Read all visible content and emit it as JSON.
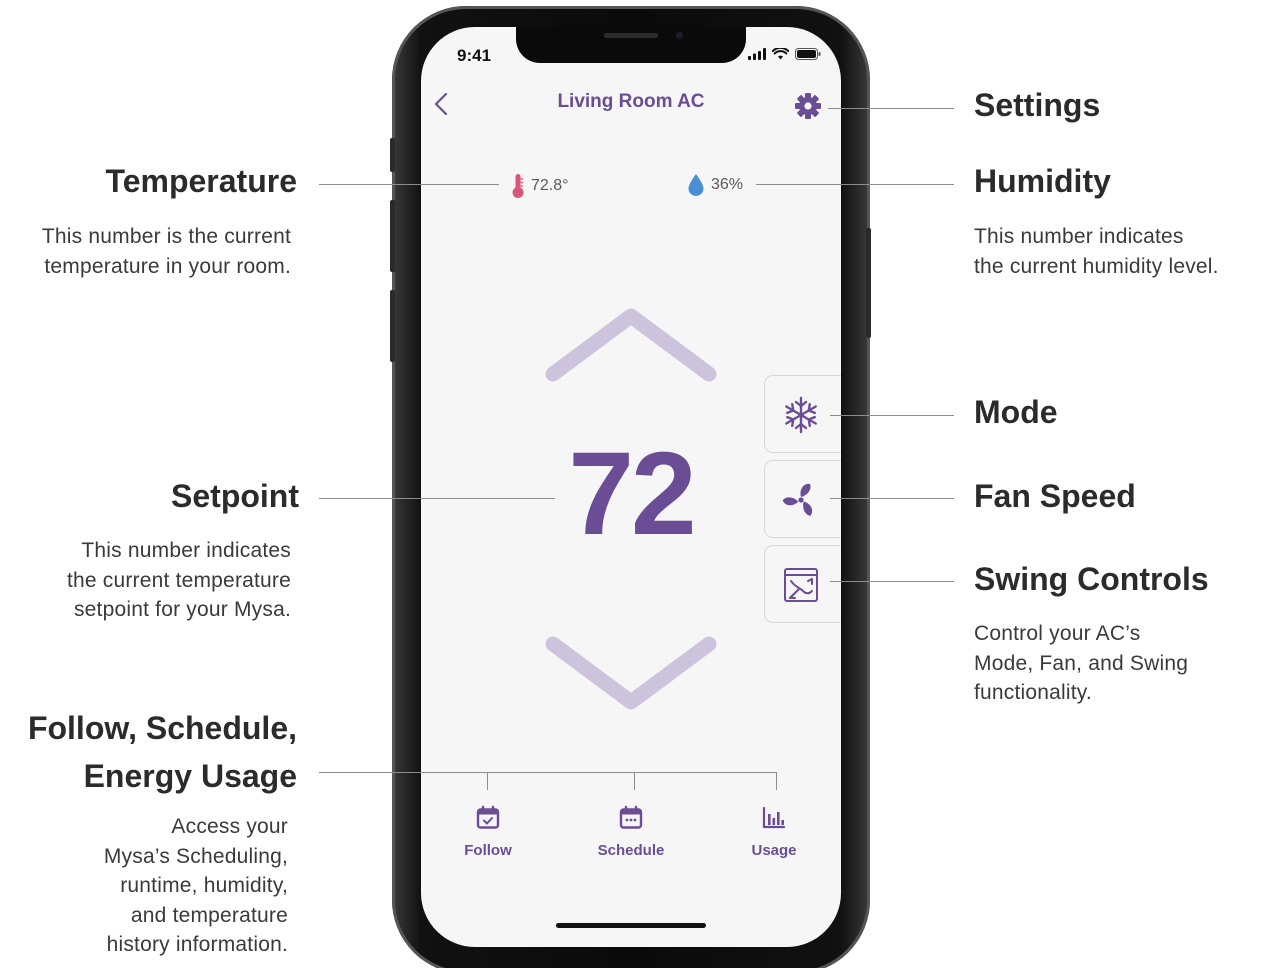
{
  "status_bar": {
    "time": "9:41"
  },
  "nav": {
    "title": "Living Room AC"
  },
  "readings": {
    "temperature": "72.8°",
    "humidity": "36%"
  },
  "setpoint": "72",
  "tabs": [
    {
      "label": "Follow",
      "icon": "calendar-check-icon"
    },
    {
      "label": "Schedule",
      "icon": "calendar-icon"
    },
    {
      "label": "Usage",
      "icon": "bar-chart-icon"
    }
  ],
  "controls": [
    {
      "name": "Mode",
      "icon": "snowflake-icon"
    },
    {
      "name": "Fan Speed",
      "icon": "fan-icon"
    },
    {
      "name": "Swing Controls",
      "icon": "swing-icon"
    }
  ],
  "annotations": {
    "settings": {
      "title": "Settings"
    },
    "temperature": {
      "title": "Temperature",
      "desc_lines": [
        "This number is the current",
        "temperature in your room."
      ]
    },
    "humidity": {
      "title": "Humidity",
      "desc_lines": [
        "This number indicates",
        "the current humidity level."
      ]
    },
    "mode": {
      "title": "Mode"
    },
    "setpoint": {
      "title": "Setpoint",
      "desc_lines": [
        "This number indicates",
        "the current temperature",
        "setpoint for your Mysa."
      ]
    },
    "fan_speed": {
      "title": "Fan Speed"
    },
    "swing": {
      "title": "Swing Controls",
      "desc_lines": [
        "Control your AC’s",
        "Mode, Fan, and Swing",
        "functionality."
      ]
    },
    "follow": {
      "title_lines": [
        "Follow, Schedule,",
        "Energy Usage"
      ],
      "desc_lines": [
        "Access your",
        "Mysa’s Scheduling,",
        "runtime, humidity,",
        "and temperature",
        "history information."
      ]
    }
  },
  "colors": {
    "accent": "#6a4d94",
    "chevron": "#cdc3dc",
    "thermometer": "#d9567a",
    "droplet": "#4a8fd6"
  }
}
